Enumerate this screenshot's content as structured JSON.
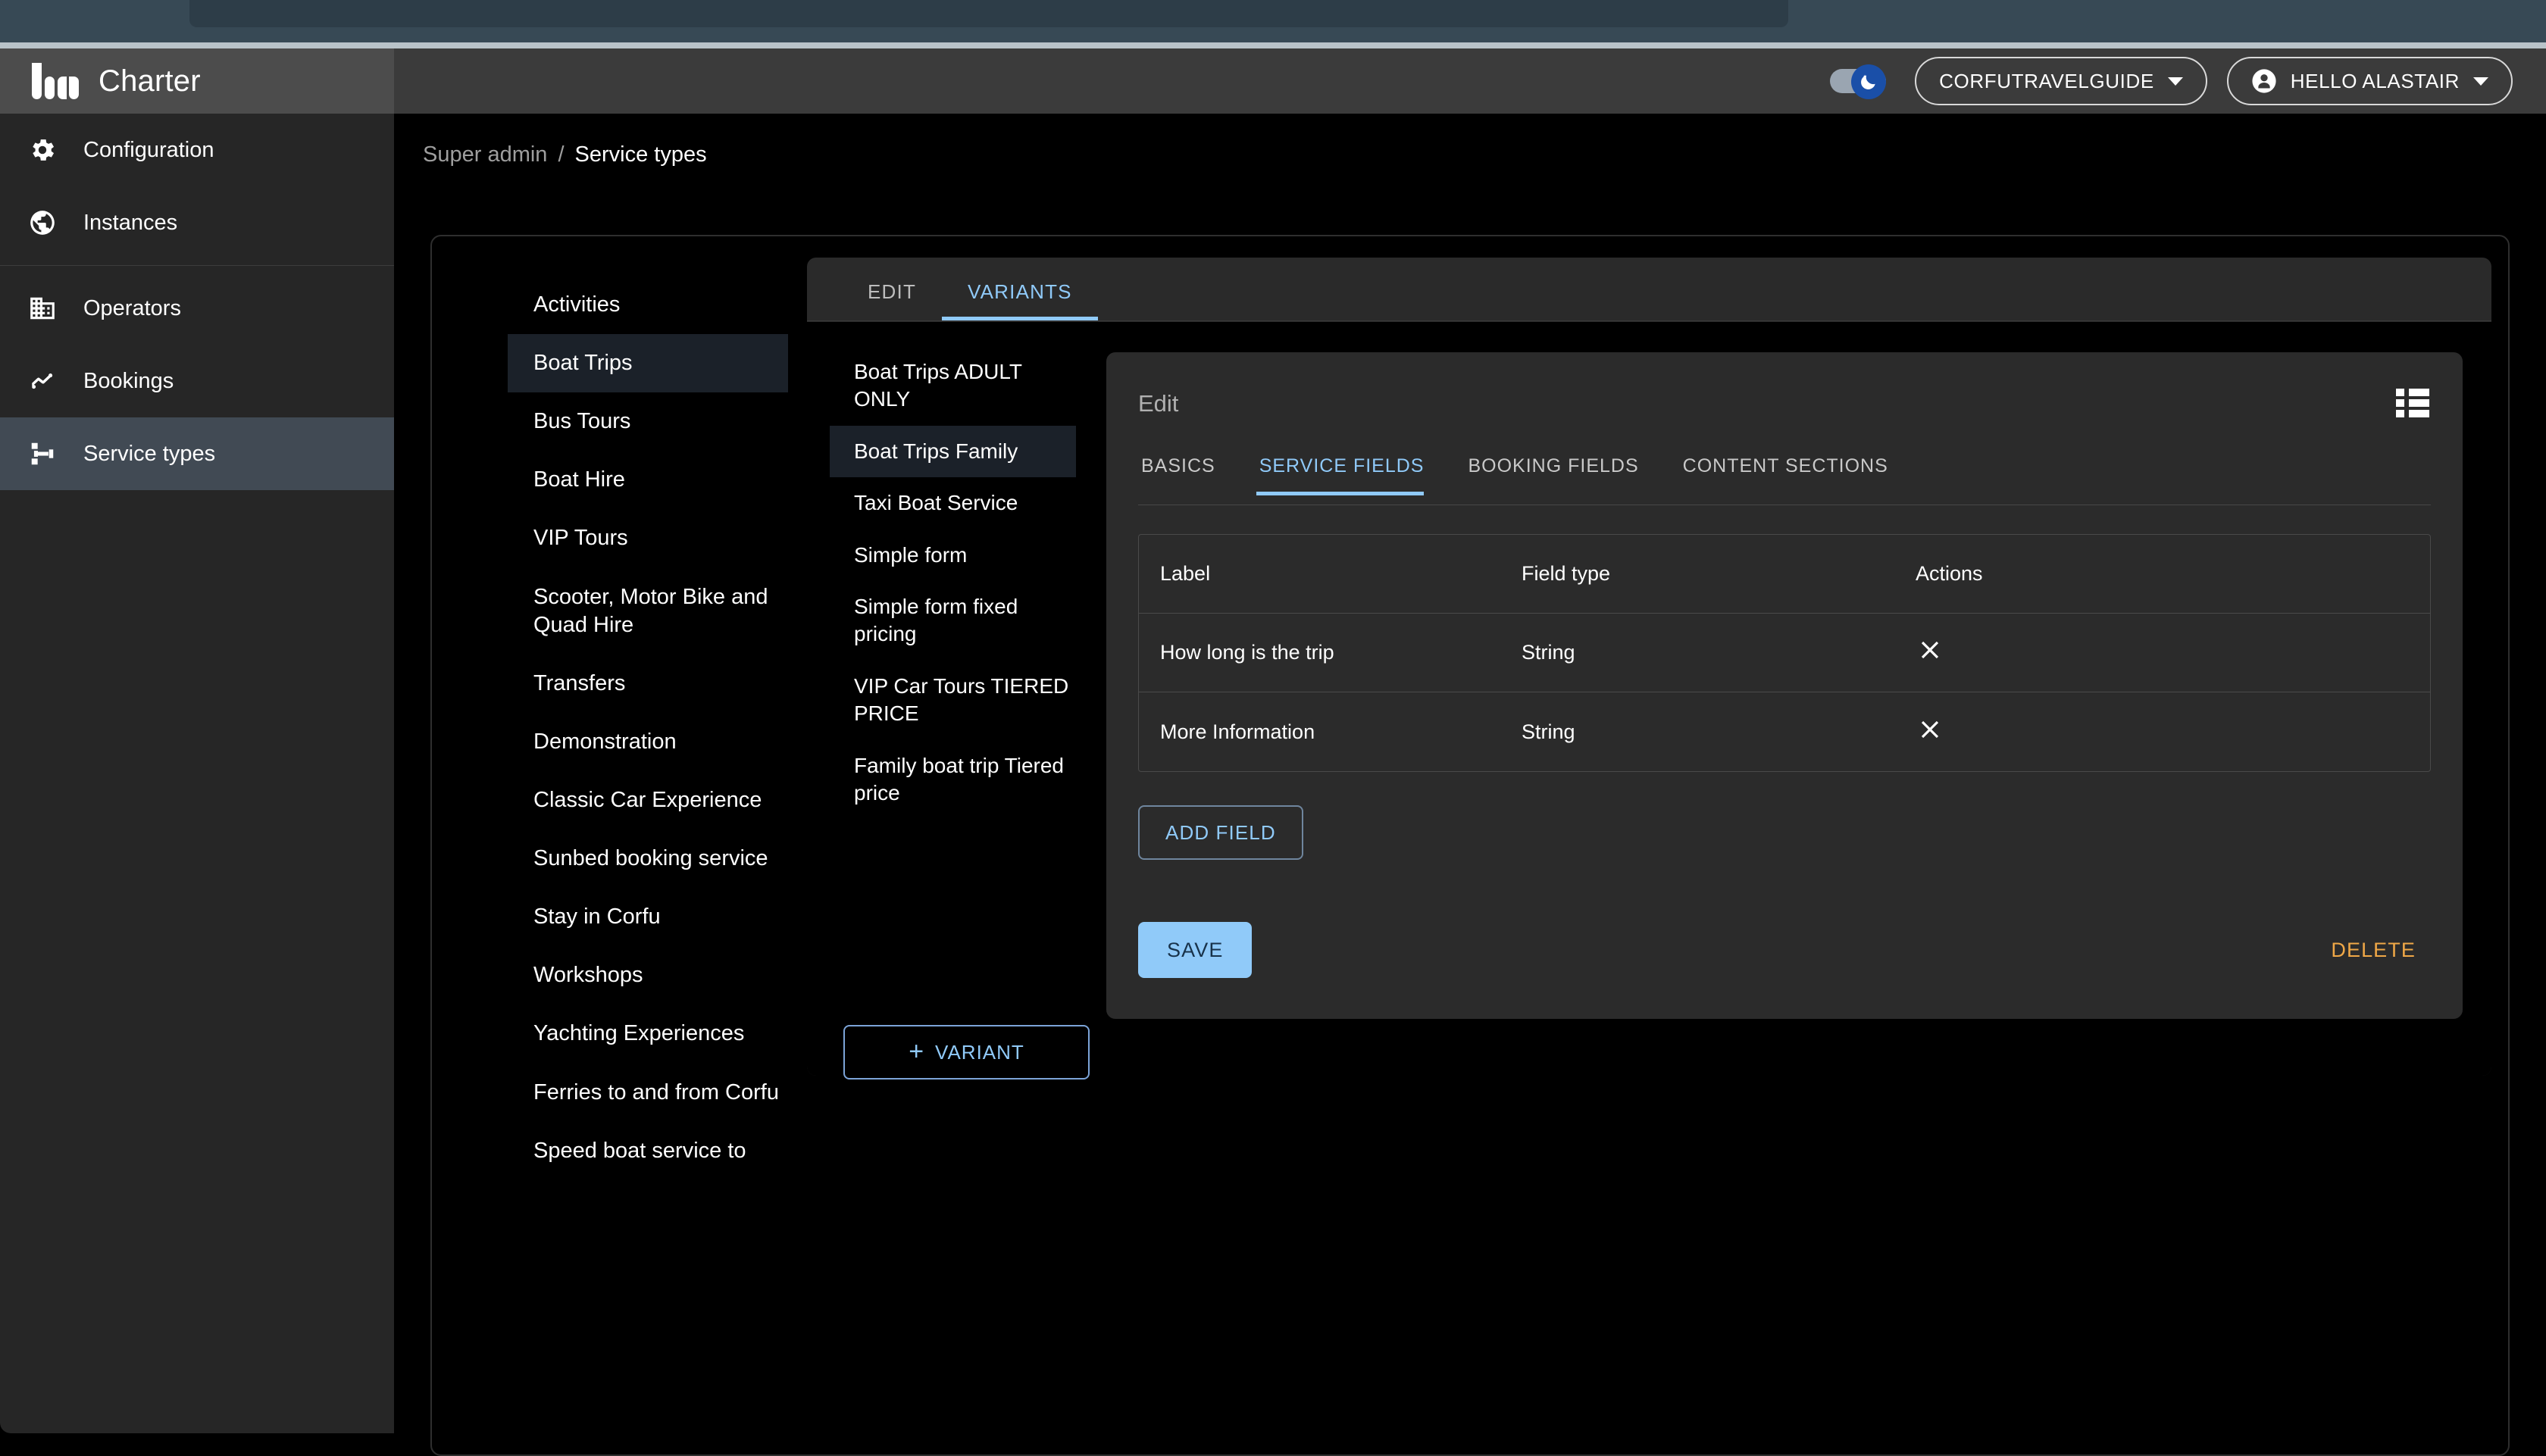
{
  "browser": {
    "chrome_color": "#374955"
  },
  "app": {
    "brand_name": "Charter",
    "logo_icon": "charter-bars-logo"
  },
  "header": {
    "theme_toggle": {
      "icon": "dark-mode-moon-icon",
      "state": "on",
      "accent": "#1a4fa8"
    },
    "tenant": {
      "label": "CORFUTRAVELGUIDE",
      "chevron": "chevron-down-icon"
    },
    "user": {
      "label": "HELLO ALASTAIR",
      "avatar_icon": "account-circle-icon",
      "chevron": "chevron-down-icon"
    }
  },
  "sidebar": {
    "items": [
      {
        "label": "Configuration",
        "icon": "gear-icon",
        "active": false
      },
      {
        "label": "Instances",
        "icon": "globe-icon",
        "active": false
      },
      {
        "label": "Operators",
        "icon": "building-icon",
        "active": false
      },
      {
        "label": "Bookings",
        "icon": "trend-line-icon",
        "active": false
      },
      {
        "label": "Service types",
        "icon": "schema-icon",
        "active": true
      }
    ],
    "active_bg": "#414a54"
  },
  "breadcrumb": {
    "root": "Super admin",
    "separator": "/",
    "current": "Service types"
  },
  "service_types": {
    "items": [
      {
        "label": "Activities",
        "active": false
      },
      {
        "label": "Boat Trips",
        "active": true
      },
      {
        "label": "Bus Tours",
        "active": false
      },
      {
        "label": "Boat Hire",
        "active": false
      },
      {
        "label": "VIP Tours",
        "active": false
      },
      {
        "label": "Scooter, Motor Bike and Quad Hire",
        "active": false
      },
      {
        "label": "Transfers",
        "active": false
      },
      {
        "label": "Demonstration",
        "active": false
      },
      {
        "label": "Classic Car Experience",
        "active": false
      },
      {
        "label": "Sunbed booking service",
        "active": false
      },
      {
        "label": "Stay in Corfu",
        "active": false
      },
      {
        "label": "Workshops",
        "active": false
      },
      {
        "label": "Yachting Experiences",
        "active": false
      },
      {
        "label": "Ferries to and from Corfu",
        "active": false
      },
      {
        "label": "Speed boat service to",
        "active": false
      }
    ]
  },
  "variants_panel": {
    "tabs": [
      {
        "label": "EDIT",
        "active": false
      },
      {
        "label": "VARIANTS",
        "active": true
      }
    ],
    "accent": "#90caf9",
    "list": [
      {
        "label": "Boat Trips ADULT ONLY",
        "active": false
      },
      {
        "label": "Boat Trips Family",
        "active": true
      },
      {
        "label": "Taxi Boat Service",
        "active": false
      },
      {
        "label": "Simple form",
        "active": false
      },
      {
        "label": "Simple form fixed pricing",
        "active": false
      },
      {
        "label": "VIP Car Tours TIERED PRICE",
        "active": false
      },
      {
        "label": "Family boat trip Tiered price",
        "active": false
      }
    ],
    "add_variant_label": "VARIANT",
    "add_variant_plus": "+"
  },
  "edit_panel": {
    "title": "Edit",
    "view_list_icon": "view-list-icon",
    "tabs": [
      {
        "label": "BASICS",
        "active": false
      },
      {
        "label": "SERVICE FIELDS",
        "active": true
      },
      {
        "label": "BOOKING FIELDS",
        "active": false
      },
      {
        "label": "CONTENT SECTIONS",
        "active": false
      }
    ],
    "fields_table": {
      "columns": [
        "Label",
        "Field type",
        "Actions"
      ],
      "rows": [
        {
          "label": "How long is the trip",
          "field_type": "String",
          "action_icon": "close-icon"
        },
        {
          "label": "More Information",
          "field_type": "String",
          "action_icon": "close-icon"
        }
      ]
    },
    "add_field_label": "ADD FIELD",
    "save_label": "SAVE",
    "delete_label": "DELETE",
    "delete_color": "#f0a847"
  }
}
